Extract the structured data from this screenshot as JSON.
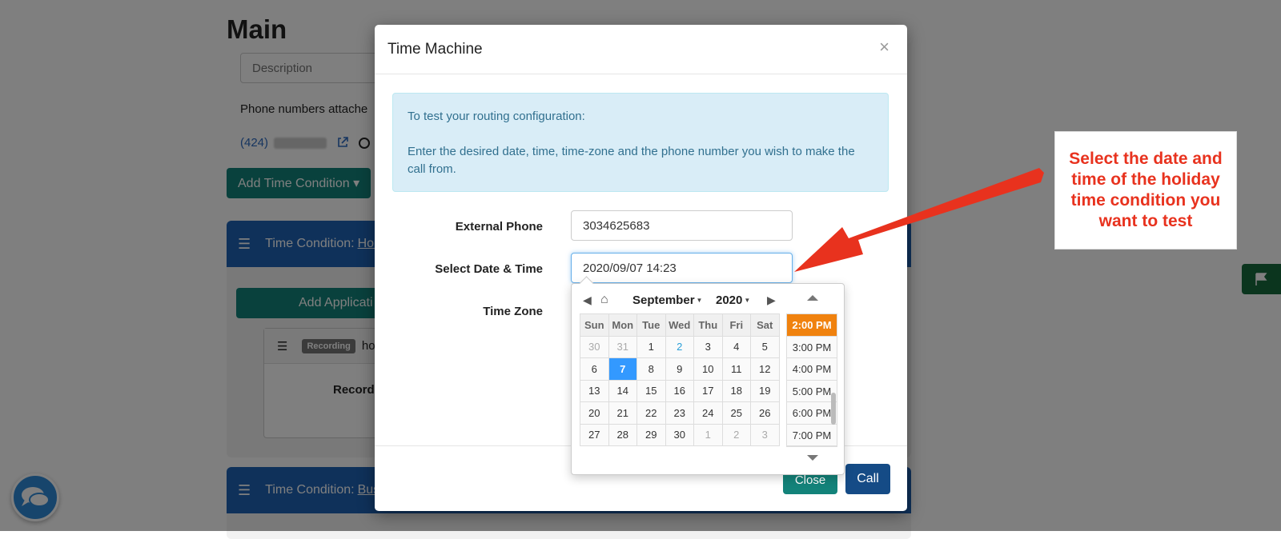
{
  "background": {
    "page_title": "Main",
    "description_placeholder": "Description",
    "phones_label": "Phone numbers attache",
    "phone_number": "(424)",
    "add_time_condition": "Add Time Condition ▾",
    "panel1": {
      "prefix": "Time Condition:",
      "link": "Holi"
    },
    "add_application": "Add Applicati",
    "recording_badge": "Recording",
    "recording_name": "ho",
    "recording_label": "Recordi",
    "panel2": {
      "prefix": "Time Condition:",
      "link": "Bus"
    }
  },
  "modal": {
    "title": "Time Machine",
    "close_symbol": "×",
    "info_line1": "To test your routing configuration:",
    "info_line2": "Enter the desired date, time, time-zone and the phone number you wish to make the call from.",
    "external_phone_label": "External Phone",
    "external_phone_value": "3034625683",
    "date_label": "Select Date & Time",
    "date_value": "2020/09/07 14:23",
    "timezone_label": "Time Zone",
    "close_button": "Close",
    "call_button": "Call"
  },
  "picker": {
    "month": "September",
    "year": "2020",
    "weekdays": [
      "Sun",
      "Mon",
      "Tue",
      "Wed",
      "Thu",
      "Fri",
      "Sat"
    ],
    "weeks": [
      [
        "30",
        "31",
        "1",
        "2",
        "3",
        "4",
        "5"
      ],
      [
        "6",
        "7",
        "8",
        "9",
        "10",
        "11",
        "12"
      ],
      [
        "13",
        "14",
        "15",
        "16",
        "17",
        "18",
        "19"
      ],
      [
        "20",
        "21",
        "22",
        "23",
        "24",
        "25",
        "26"
      ],
      [
        "27",
        "28",
        "29",
        "30",
        "1",
        "2",
        "3"
      ]
    ],
    "selected_day": "7",
    "times": [
      "2:00 PM",
      "3:00 PM",
      "4:00 PM",
      "5:00 PM",
      "6:00 PM",
      "7:00 PM"
    ],
    "selected_time": "2:00 PM"
  },
  "annotation": {
    "text": "Select the date and time of the holiday time condition you want to test",
    "color": "#e8321e"
  },
  "colors": {
    "teal": "#13837a",
    "blue": "#1e63b5",
    "call_blue": "#154b86",
    "selected_day": "#3399ff",
    "selected_time": "#f0820f"
  }
}
